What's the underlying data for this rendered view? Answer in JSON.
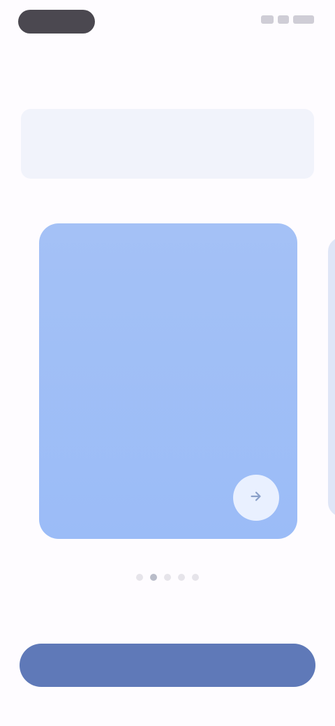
{
  "status_bar": {
    "time": "",
    "icons": [
      "signal-icon",
      "wifi-icon",
      "battery-icon"
    ]
  },
  "prompt_section": {
    "label": "",
    "message": ""
  },
  "carousel": {
    "current_index": 1,
    "total": 5,
    "cards": [
      {
        "title": "",
        "body": "",
        "action_icon": "arrow-right-icon"
      }
    ]
  },
  "primary_button": {
    "label": ""
  },
  "colors": {
    "background": "#fefcff",
    "card": "#a4c1f6",
    "button": "#5f79b8",
    "message_box": "#f1f3fb"
  }
}
